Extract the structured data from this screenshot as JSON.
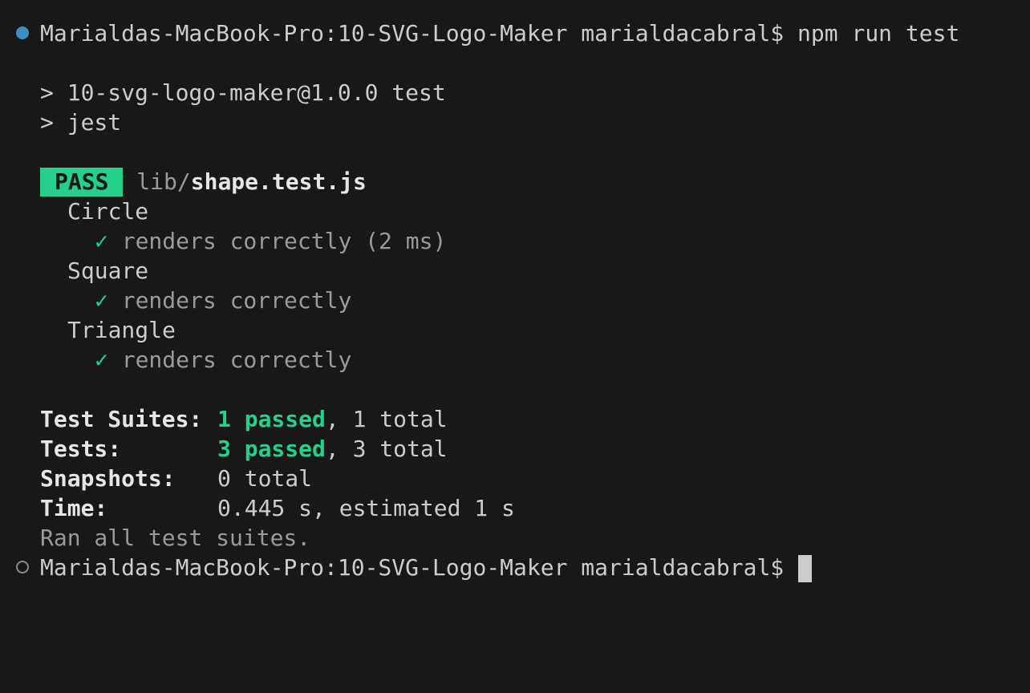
{
  "prompt": {
    "host_path": "Marialdas-MacBook-Pro:10-SVG-Logo-Maker marialdacabral$",
    "command": "npm run test"
  },
  "npm_output": {
    "line1": "> 10-svg-logo-maker@1.0.0 test",
    "line2": "> jest"
  },
  "result": {
    "badge": "PASS",
    "file_dir": "lib/",
    "file_name": "shape.test.js",
    "groups": [
      {
        "name": "Circle",
        "check": "✓",
        "test": "renders correctly (2 ms)"
      },
      {
        "name": "Square",
        "check": "✓",
        "test": "renders correctly"
      },
      {
        "name": "Triangle",
        "check": "✓",
        "test": "renders correctly"
      }
    ]
  },
  "summary": {
    "suites_label": "Test Suites:",
    "suites_passed": "1 passed",
    "suites_total": ", 1 total",
    "tests_label": "Tests:",
    "tests_passed": "3 passed",
    "tests_total": ", 3 total",
    "snapshots_label": "Snapshots:",
    "snapshots_value": "0 total",
    "time_label": "Time:",
    "time_value": "0.445 s, estimated 1 s",
    "ran_all": "Ran all test suites."
  },
  "colors": {
    "background": "#181818",
    "pass_green": "#23d18b",
    "dot_blue": "#3b8fc6"
  }
}
